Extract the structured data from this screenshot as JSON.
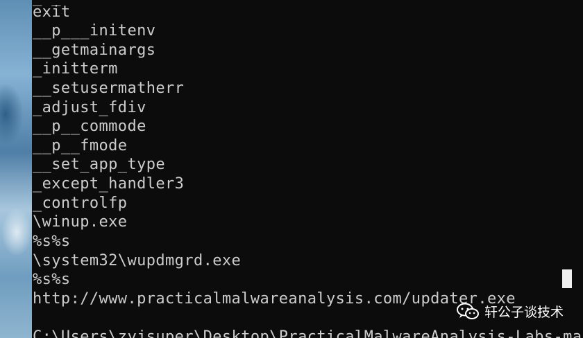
{
  "console": {
    "lines": [
      "exit",
      "__p___initenv",
      "__getmainargs",
      "_initterm",
      "__setusermatherr",
      "_adjust_fdiv",
      "__p__commode",
      "__p__fmode",
      "__set_app_type",
      "_except_handler3",
      "_controlfp",
      "\\winup.exe",
      "%s%s",
      "\\system32\\wupdmgrd.exe",
      "%s%s",
      "http://www.practicalmalwareanalysis.com/updater.exe",
      "",
      "C:\\Users\\zyjsuper\\Desktop\\PracticalMalwareAnalysis-Labs-mas"
    ]
  },
  "watermark": {
    "icon": "wechat-icon",
    "text": "轩公子谈技术"
  },
  "colors": {
    "background": "#0c0c0c",
    "text": "#cccccc",
    "cursor": "#f0f0f0"
  }
}
